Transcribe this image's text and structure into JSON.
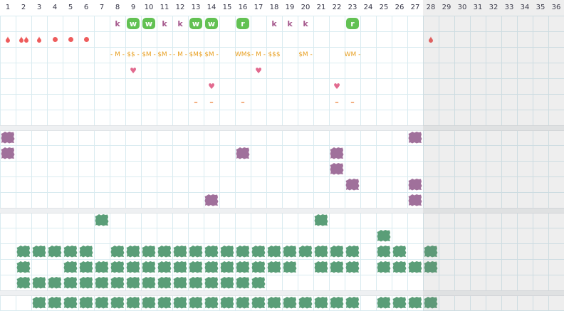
{
  "colors": {
    "grid_line": "#d9ebf0",
    "separator": "#eef0f2",
    "future_shade": "#ececec",
    "green_badge": "#62c153",
    "purple_blob": "#a0709b",
    "teal_blob": "#5a9e78",
    "pink": "#e26a8f",
    "red_dot": "#ee5c5c",
    "orange_text": "#e8a023",
    "k_text": "#a65a8e",
    "dash": "#ee8a47"
  },
  "days": [
    "1",
    "2",
    "3",
    "4",
    "5",
    "6",
    "7",
    "8",
    "9",
    "10",
    "11",
    "12",
    "13",
    "14",
    "15",
    "16",
    "17",
    "18",
    "19",
    "20",
    "21",
    "22",
    "23",
    "24",
    "25",
    "26",
    "27",
    "28",
    "29",
    "30",
    "31",
    "32",
    "33",
    "34",
    "35",
    "36"
  ],
  "today_boundary_day": 28,
  "top_rows": {
    "letters": [
      {
        "day": 8,
        "kind": "k",
        "text": "k"
      },
      {
        "day": 9,
        "kind": "badge",
        "text": "w"
      },
      {
        "day": 10,
        "kind": "badge",
        "text": "w"
      },
      {
        "day": 11,
        "kind": "k",
        "text": "k"
      },
      {
        "day": 12,
        "kind": "k",
        "text": "k"
      },
      {
        "day": 13,
        "kind": "badge",
        "text": "w"
      },
      {
        "day": 14,
        "kind": "badge",
        "text": "w"
      },
      {
        "day": 16,
        "kind": "badge",
        "text": "r"
      },
      {
        "day": 18,
        "kind": "k",
        "text": "k"
      },
      {
        "day": 19,
        "kind": "k",
        "text": "k"
      },
      {
        "day": 20,
        "kind": "k",
        "text": "k"
      },
      {
        "day": 23,
        "kind": "badge",
        "text": "r"
      }
    ],
    "markers": [
      {
        "day": 1,
        "kind": "drop1"
      },
      {
        "day": 2,
        "kind": "drop2"
      },
      {
        "day": 3,
        "kind": "drop1"
      },
      {
        "day": 4,
        "kind": "dot"
      },
      {
        "day": 5,
        "kind": "dot"
      },
      {
        "day": 6,
        "kind": "dot"
      },
      {
        "day": 28,
        "kind": "drop1"
      }
    ],
    "codes": [
      {
        "day": 8,
        "text": "- M -"
      },
      {
        "day": 9,
        "text": "$$ -"
      },
      {
        "day": 10,
        "text": "$M -"
      },
      {
        "day": 11,
        "text": "$M -"
      },
      {
        "day": 12,
        "text": "- M -"
      },
      {
        "day": 13,
        "text": "$M$"
      },
      {
        "day": 14,
        "text": "$M -"
      },
      {
        "day": 16,
        "text": "WM$"
      },
      {
        "day": 17,
        "text": "- M -"
      },
      {
        "day": 18,
        "text": "$$$"
      },
      {
        "day": 20,
        "text": "$M -"
      },
      {
        "day": 23,
        "text": "WM -"
      }
    ],
    "hearts": [
      9,
      14,
      17,
      22
    ],
    "dashes": [
      {
        "day": 13,
        "text": "–"
      },
      {
        "day": 14,
        "text": "–"
      },
      {
        "day": 16,
        "text": "–"
      },
      {
        "day": 22,
        "text": "–"
      },
      {
        "day": 23,
        "text": "–"
      }
    ]
  },
  "purple_rows": [
    [
      1,
      27
    ],
    [
      1,
      16,
      22
    ],
    [
      22
    ],
    [
      23,
      27
    ],
    [
      14,
      27
    ]
  ],
  "teal_rows": [
    [
      7,
      21
    ],
    [
      25
    ],
    [
      2,
      3,
      4,
      5,
      6,
      8,
      9,
      10,
      11,
      12,
      13,
      14,
      15,
      16,
      17,
      18,
      19,
      20,
      21,
      22,
      23,
      25,
      26,
      28
    ],
    [
      2,
      5,
      6,
      7,
      8,
      9,
      10,
      11,
      12,
      13,
      14,
      15,
      16,
      17,
      18,
      19,
      21,
      22,
      23,
      25,
      26,
      27,
      28
    ],
    [
      2,
      3,
      4,
      5,
      6,
      7,
      8,
      9,
      10,
      11,
      12,
      13,
      14,
      15,
      16,
      17
    ]
  ],
  "teal_bottom_row": [
    3,
    4,
    5,
    6,
    7,
    8,
    9,
    10,
    11,
    12,
    13,
    14,
    15,
    16,
    17,
    18,
    19,
    20,
    21,
    22,
    23,
    25,
    26,
    27,
    28
  ]
}
